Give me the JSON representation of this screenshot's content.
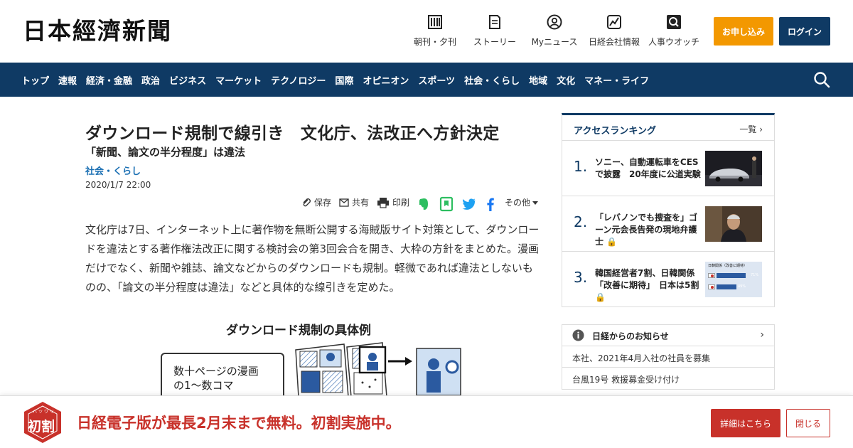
{
  "header": {
    "logo": "日本經濟新聞",
    "utility": [
      {
        "label": "朝刊・夕刊",
        "icon": "newspaper-icon"
      },
      {
        "label": "ストーリー",
        "icon": "document-icon"
      },
      {
        "label": "Myニュース",
        "icon": "user-icon"
      },
      {
        "label": "日経会社情報",
        "icon": "chart-icon"
      },
      {
        "label": "人事ウオッチ",
        "icon": "search-person-icon"
      }
    ],
    "apply_label": "お申し込み",
    "login_label": "ログイン"
  },
  "nav": {
    "items": [
      "トップ",
      "速報",
      "経済・金融",
      "政治",
      "ビジネス",
      "マーケット",
      "テクノロジー",
      "国際",
      "オピニオン",
      "スポーツ",
      "社会・くらし",
      "地域",
      "文化",
      "マネー・ライフ"
    ]
  },
  "article": {
    "headline": "ダウンロード規制で線引き　文化庁、法改正へ方針決定",
    "subhead": "「新聞、論文の半分程度」は違法",
    "category": "社会・くらし",
    "date": "2020/1/7 22:00",
    "actions": {
      "save": "保存",
      "share": "共有",
      "print": "印刷",
      "more": "その他"
    },
    "body": "文化庁は7日、インターネット上に著作物を無断公開する海賊版サイト対策として、ダウンロードを違法とする著作権法改正に関する検討会の第3回会合を開き、大枠の方針をまとめた。漫画だけでなく、新聞や雑誌、論文などからのダウンロードも規制。軽微であれば違法としないものの、「論文の半分程度は違法」などと具体的な線引きを定めた。",
    "figure": {
      "title": "ダウンロード規制の具体例",
      "box_text": "数十ページの漫画の1～数コマ"
    }
  },
  "ranking": {
    "title": "アクセスランキング",
    "more": "一覧",
    "items": [
      {
        "rank": "1.",
        "text": "ソニー、自動運転車をCESで披露　20年度に公道実験"
      },
      {
        "rank": "2.",
        "text": "「レバノンでも捜査を」ゴーン元会長告発の現地弁護士"
      },
      {
        "rank": "3.",
        "text": "韓国経営者7割、日韓関係「改善に期待」　日本は5割"
      }
    ],
    "thumb3": {
      "caption": "日韓関係（改善に期待）",
      "kr_pct": "71%",
      "jp_pct": "49%",
      "kr_value": 71,
      "jp_value": 49
    }
  },
  "notices": {
    "title": "日経からのお知らせ",
    "items": [
      "本社、2021年4月入社の社員を募集",
      "台風19号 救援募金受け付け"
    ]
  },
  "promo": {
    "badge_main": "初割",
    "badge_ruby": "ハツワリ",
    "text": "日経電子版が最長2月末まで無料。初割実施中。",
    "detail_label": "詳細はこちら",
    "close_label": "閉じる"
  },
  "colors": {
    "navy": "#0f3a64",
    "orange": "#f39800",
    "red": "#c8312a",
    "link": "#1a6fb3"
  }
}
